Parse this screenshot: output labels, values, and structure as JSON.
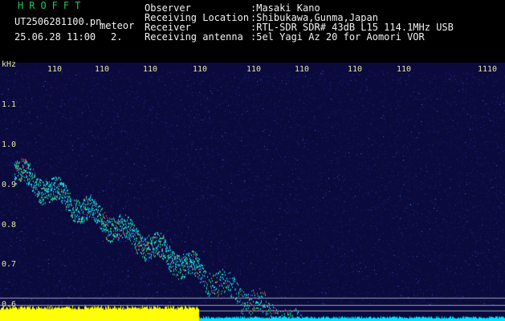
{
  "header": {
    "app_title": "HROFFT",
    "file_name": "UT2506281100.pn",
    "mode": "meteor",
    "datetime": "25.06.28 11:00",
    "count": "2.",
    "info": [
      {
        "label": "Observer",
        "value": ":Masaki Kano"
      },
      {
        "label": "Receiving Location",
        "value": ":Shibukawa,Gunma,Japan"
      },
      {
        "label": "Receiver",
        "value": ":RTL-SDR SDR# 43dB L15 114.1MHz USB"
      },
      {
        "label": "Receiving antenna",
        "value": ":5el Yagi Az 20 for Aomori VOR"
      }
    ]
  },
  "axis": {
    "y_unit": "kHz",
    "y_ticks": [
      "1.1",
      "1.0",
      "0.9",
      "0.8",
      "0.7",
      "0.6"
    ],
    "x_ticks": [
      "110",
      "110",
      "110",
      "110",
      "110",
      "110",
      "110",
      "110",
      "1110"
    ]
  },
  "colors": {
    "background": "#0a0a3c",
    "noise": "#1a1a70",
    "signal_cyan": "#00e5ff",
    "signal_green": "#22c55e",
    "signal_red": "#ff3030",
    "bottom_bar": "#ffff00",
    "grid_line": "#9aa0b8"
  }
}
